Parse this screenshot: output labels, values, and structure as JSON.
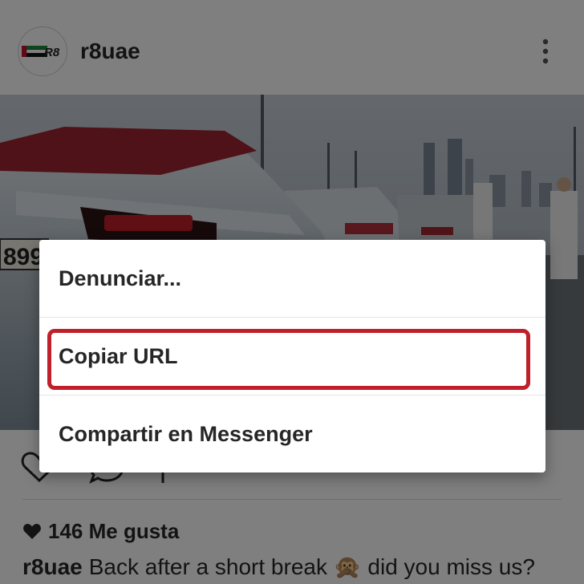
{
  "post": {
    "username": "r8uae",
    "avatar_text": "R8",
    "likes_text": "146 Me gusta",
    "caption_user": "r8uae",
    "caption_text": "Back after a short break 🙊 did you miss us?",
    "plate_text": "899"
  },
  "icons": {
    "more": "more-vertical-icon",
    "like": "heart-outline-icon",
    "comment": "comment-icon",
    "share": "share-icon",
    "likes": "heart-filled-icon"
  },
  "menu": {
    "items": [
      {
        "label": "Denunciar..."
      },
      {
        "label": "Copiar URL",
        "highlighted": true
      },
      {
        "label": "Compartir en Messenger"
      }
    ]
  },
  "colors": {
    "highlight_border": "#c0202a",
    "text": "#262626",
    "scrim": "rgba(0,0,0,0.5)"
  }
}
